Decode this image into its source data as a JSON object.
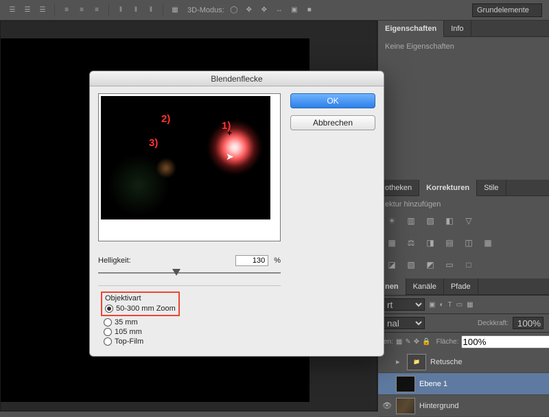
{
  "toolbar": {
    "mode_label": "3D-Modus:",
    "workspace": "Grundelemente"
  },
  "properties": {
    "tab_props": "Eigenschaften",
    "tab_info": "Info",
    "no_props": "Keine Eigenschaften"
  },
  "libraries": {
    "lib": "otheken",
    "adjust": "Korrekturen",
    "styles": "Stile",
    "add_adjustment": "ektur hinzufügen"
  },
  "layers_panel": {
    "tab_layers": "nen",
    "tab_channels": "Kanäle",
    "tab_paths": "Pfade",
    "filter": "rt",
    "opacity_label": "Deckkraft:",
    "opacity_value": "100%",
    "fill_label": "Fläche:",
    "fill_value": "100%",
    "blend": "nal",
    "lock_label": "en:"
  },
  "layers": {
    "items": [
      {
        "name": "Retusche"
      },
      {
        "name": "Ebene 1"
      },
      {
        "name": "Hintergrund"
      }
    ]
  },
  "dialog": {
    "title": "Blendenflecke",
    "ok": "OK",
    "cancel": "Abbrechen",
    "brightness_label": "Helligkeit:",
    "brightness_value": "130",
    "percent": "%",
    "lens_label": "Objektivart",
    "lens_options": {
      "zoom": "50-300 mm Zoom",
      "mm35": "35 mm",
      "mm105": "105 mm",
      "top": "Top-Film"
    },
    "annotations": {
      "a1": "1)",
      "a2": "2)",
      "a3": "3)"
    }
  }
}
